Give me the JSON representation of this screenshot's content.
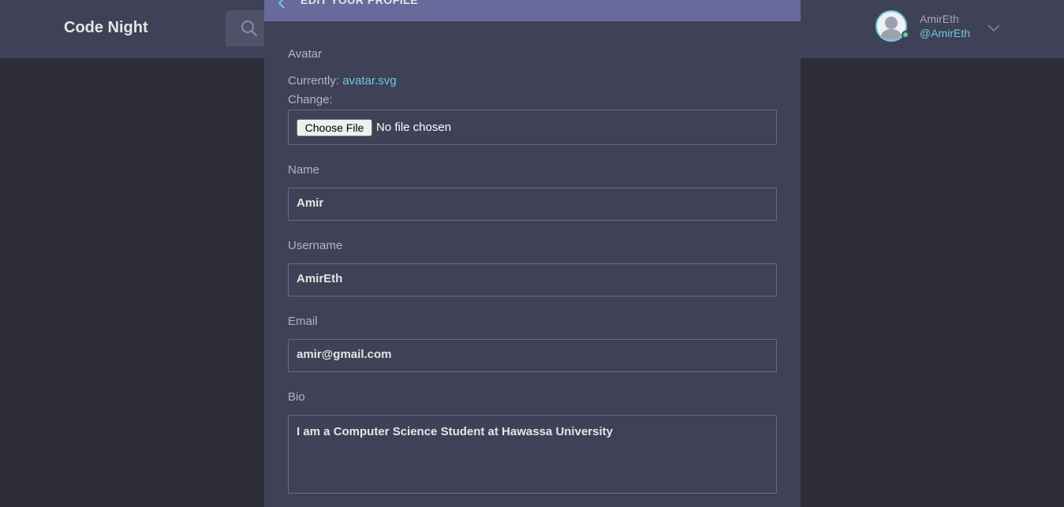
{
  "app": {
    "title": "Code Night"
  },
  "header": {
    "search_icon": "search-icon",
    "user": {
      "name": "AmirEth",
      "handle": "@AmirEth",
      "status": "online",
      "menu_icon": "chevron-down-icon"
    }
  },
  "panel": {
    "title": "EDIT YOUR PROFILE",
    "back_icon": "arrow-left-icon",
    "avatar": {
      "label": "Avatar",
      "currently_label": "Currently:",
      "currently_file": "avatar.svg",
      "change_label": "Change:",
      "choose_button": "Choose File",
      "no_file_text": "No file chosen"
    },
    "fields": {
      "name": {
        "label": "Name",
        "value": "Amir"
      },
      "username": {
        "label": "Username",
        "value": "AmirEth"
      },
      "email": {
        "label": "Email",
        "value": "amir@gmail.com"
      },
      "bio": {
        "label": "Bio",
        "value": "I am a Computer Science Student at Hawassa University"
      }
    }
  },
  "colors": {
    "header_bg": "#3f4156",
    "page_bg": "#2d2d39",
    "panel_header_bg": "#686a9b",
    "accent": "#71c6dd",
    "online": "#5dd693"
  }
}
